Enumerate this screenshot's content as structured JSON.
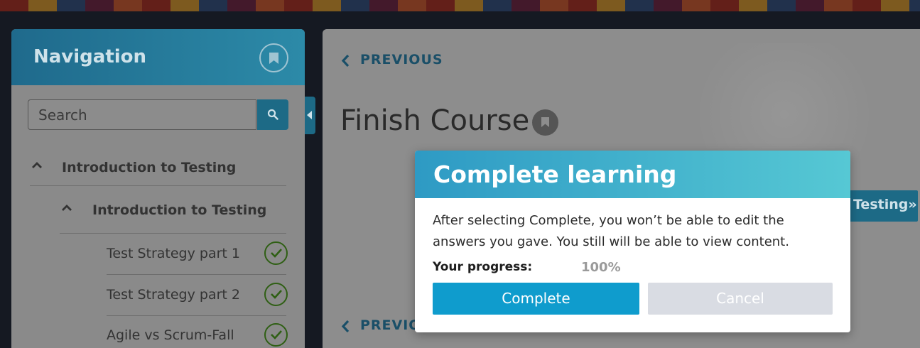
{
  "sidebar": {
    "title": "Navigation",
    "search": {
      "placeholder": "Search"
    },
    "items": [
      {
        "label": "Introduction to Testing",
        "level": 1,
        "expanded": true
      },
      {
        "label": "Introduction to Testing",
        "level": 2,
        "expanded": true
      },
      {
        "label": "Test Strategy part 1",
        "level": 3,
        "completed": true
      },
      {
        "label": "Test Strategy part 2",
        "level": 3,
        "completed": true
      },
      {
        "label": "Agile vs Scrum-Fall",
        "level": 3,
        "completed": true
      }
    ]
  },
  "main": {
    "previous_label": "PREVIOUS",
    "previous_bottom_label": "PREVIOU",
    "page_title": "Finish Course",
    "next_label": "Testing»"
  },
  "modal": {
    "title": "Complete learning",
    "message": "After selecting Complete, you won’t be able to edit the answers you gave. You still will be able to view content.",
    "progress_label": "Your progress:",
    "progress_value": "100%",
    "complete_label": "Complete",
    "cancel_label": "Cancel"
  },
  "colors": {
    "accent": "#0f9ccd",
    "header_gradient_start": "#2e9ac4",
    "header_gradient_end": "#56c8d4",
    "check_green": "#2f5f14"
  },
  "icons": [
    "bookmark-icon",
    "search-icon",
    "chevron-up-icon",
    "check-circle-icon",
    "chevron-left-icon"
  ]
}
